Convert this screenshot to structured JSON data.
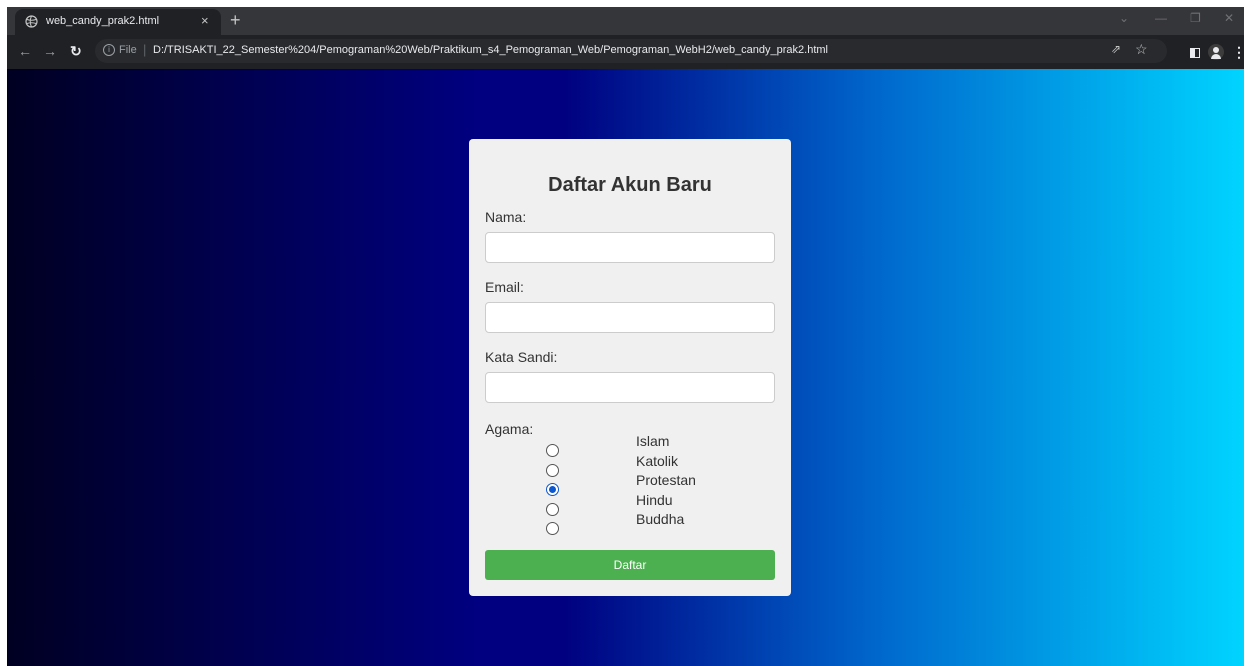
{
  "browser": {
    "tab_title": "web_candy_prak2.html",
    "tab_close": "×",
    "new_tab": "+",
    "address": {
      "scheme_label": "File",
      "url": "D:/TRISAKTI_22_Semester%204/Pemograman%20Web/Praktikum_s4_Pemograman_Web/Pemograman_WebH2/web_candy_prak2.html"
    }
  },
  "form": {
    "title": "Daftar Akun Baru",
    "name_label": "Nama:",
    "email_label": "Email:",
    "password_label": "Kata Sandi:",
    "religion_label": "Agama:",
    "religion_options": [
      {
        "label": "Islam",
        "checked": false
      },
      {
        "label": "Katolik",
        "checked": false
      },
      {
        "label": "Protestan",
        "checked": true
      },
      {
        "label": "Hindu",
        "checked": false
      },
      {
        "label": "Buddha",
        "checked": false
      }
    ],
    "submit_label": "Daftar"
  },
  "colors": {
    "submit_button": "#4caf50",
    "radio_selected": "#0b57d0",
    "card_background": "#f0f0f0",
    "gradient": [
      "#000022",
      "#000080",
      "#0066cc",
      "#00d4ff"
    ]
  }
}
